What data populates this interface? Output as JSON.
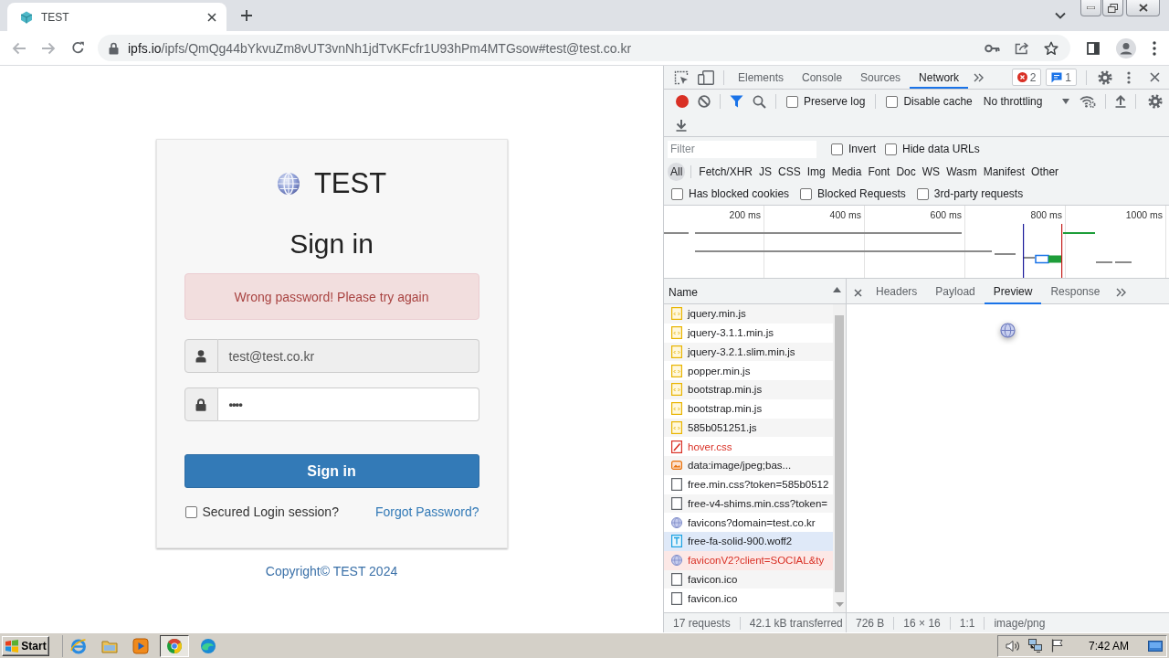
{
  "browser": {
    "tab": {
      "title": "TEST"
    },
    "url": {
      "host": "ipfs.io",
      "path": "/ipfs/QmQg44bYkvuZm8vUT3vnNh1jdTvKFcfr1U93hPm4MTGsow#test@test.co.kr"
    }
  },
  "login": {
    "brand": "TEST",
    "heading": "Sign in",
    "alert": "Wrong password! Please try again",
    "email": {
      "value": "test@test.co.kr",
      "readonly": true
    },
    "password": {
      "value": "••••",
      "readonly": false
    },
    "submit": "Sign in",
    "remember": {
      "label": "Secured Login session?",
      "checked": false
    },
    "forgot": "Forgot Password?",
    "footer": "Copyright© TEST 2024"
  },
  "devtools": {
    "tabs": [
      {
        "label": "Elements",
        "selected": false
      },
      {
        "label": "Console",
        "selected": false
      },
      {
        "label": "Sources",
        "selected": false
      },
      {
        "label": "Network",
        "selected": true
      }
    ],
    "errors": "2",
    "messages": "1",
    "preserve_log": {
      "label": "Preserve log",
      "checked": false
    },
    "disable_cache": {
      "label": "Disable cache",
      "checked": false
    },
    "throttling": "No throttling",
    "filter": {
      "placeholder": "Filter"
    },
    "invert": {
      "label": "Invert",
      "checked": false
    },
    "hide_data_urls": {
      "label": "Hide data URLs",
      "checked": false
    },
    "types": [
      {
        "label": "All",
        "selected": true
      },
      {
        "label": "Fetch/XHR",
        "selected": false
      },
      {
        "label": "JS",
        "selected": false
      },
      {
        "label": "CSS",
        "selected": false
      },
      {
        "label": "Img",
        "selected": false
      },
      {
        "label": "Media",
        "selected": false
      },
      {
        "label": "Font",
        "selected": false
      },
      {
        "label": "Doc",
        "selected": false
      },
      {
        "label": "WS",
        "selected": false
      },
      {
        "label": "Wasm",
        "selected": false
      },
      {
        "label": "Manifest",
        "selected": false
      },
      {
        "label": "Other",
        "selected": false
      }
    ],
    "extra_filters": [
      {
        "label": "Has blocked cookies",
        "checked": false
      },
      {
        "label": "Blocked Requests",
        "checked": false
      },
      {
        "label": "3rd-party requests",
        "checked": false
      }
    ],
    "overview": {
      "ticks": [
        "200 ms",
        "400 ms",
        "600 ms",
        "800 ms",
        "1000 ms"
      ]
    },
    "requests": {
      "column": "Name",
      "rows": [
        {
          "name": "jquery.min.js",
          "kind": "script",
          "failed": false,
          "selected": false,
          "hovered": false
        },
        {
          "name": "jquery-3.1.1.min.js",
          "kind": "script",
          "failed": false,
          "selected": false,
          "hovered": false
        },
        {
          "name": "jquery-3.2.1.slim.min.js",
          "kind": "script",
          "failed": false,
          "selected": false,
          "hovered": false
        },
        {
          "name": "popper.min.js",
          "kind": "script",
          "failed": false,
          "selected": false,
          "hovered": false
        },
        {
          "name": "bootstrap.min.js",
          "kind": "script",
          "failed": false,
          "selected": false,
          "hovered": false
        },
        {
          "name": "bootstrap.min.js",
          "kind": "script",
          "failed": false,
          "selected": false,
          "hovered": false
        },
        {
          "name": "585b051251.js",
          "kind": "script",
          "failed": false,
          "selected": false,
          "hovered": false
        },
        {
          "name": "hover.css",
          "kind": "stylesheet",
          "failed": true,
          "selected": false,
          "hovered": false
        },
        {
          "name": "data:image/jpeg;bas...",
          "kind": "image",
          "failed": false,
          "selected": false,
          "hovered": false
        },
        {
          "name": "free.min.css?token=585b0512",
          "kind": "document",
          "failed": false,
          "selected": false,
          "hovered": false
        },
        {
          "name": "free-v4-shims.min.css?token=",
          "kind": "document",
          "failed": false,
          "selected": false,
          "hovered": false
        },
        {
          "name": "favicons?domain=test.co.kr",
          "kind": "favicon",
          "failed": false,
          "selected": false,
          "hovered": false
        },
        {
          "name": "free-fa-solid-900.woff2",
          "kind": "font",
          "failed": false,
          "selected": false,
          "hovered": true
        },
        {
          "name": "faviconV2?client=SOCIAL&ty",
          "kind": "favicon",
          "failed": true,
          "selected": true,
          "hovered": false
        },
        {
          "name": "favicon.ico",
          "kind": "document",
          "failed": false,
          "selected": false,
          "hovered": false
        },
        {
          "name": "favicon.ico",
          "kind": "document",
          "failed": false,
          "selected": false,
          "hovered": false
        }
      ]
    },
    "summary": [
      "17 requests",
      "42.1 kB transferred"
    ],
    "detail": {
      "tabs": [
        {
          "label": "Headers",
          "selected": false
        },
        {
          "label": "Payload",
          "selected": false
        },
        {
          "label": "Preview",
          "selected": true
        },
        {
          "label": "Response",
          "selected": false
        }
      ]
    },
    "preview_info": [
      "726 B",
      "16 × 16",
      "1:1",
      "image/png"
    ]
  },
  "taskbar": {
    "start": "Start",
    "apps": [
      {
        "kind": "ie",
        "active": false
      },
      {
        "kind": "folder",
        "active": false
      },
      {
        "kind": "media",
        "active": false
      },
      {
        "kind": "chrome",
        "active": true
      },
      {
        "kind": "edge",
        "active": false
      }
    ],
    "clock": "7:42 AM"
  }
}
